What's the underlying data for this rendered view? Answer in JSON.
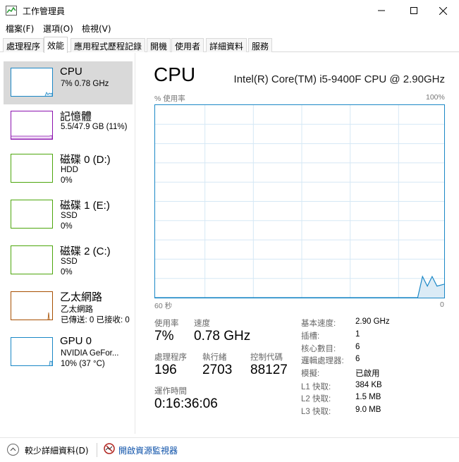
{
  "window": {
    "title": "工作管理員",
    "minimize_glyph": "—",
    "close_glyph": "✕"
  },
  "menu": {
    "items": [
      "檔案(F)",
      "選項(O)",
      "檢視(V)"
    ]
  },
  "tabs": {
    "items": [
      "處理程序",
      "效能",
      "應用程式歷程記錄",
      "開機",
      "使用者",
      "詳細資料",
      "服務"
    ],
    "active_index": 1
  },
  "resources": [
    {
      "name": "CPU",
      "line1": "7% 0.78 GHz",
      "line2": "",
      "color": "#1a87c6",
      "selected": true
    },
    {
      "name": "記憶體",
      "line1": "5.5/47.9 GB (11%)",
      "line2": "",
      "color": "#8b12ae",
      "selected": false
    },
    {
      "name": "磁碟 0 (D:)",
      "line1": "HDD",
      "line2": "0%",
      "color": "#4da60c",
      "selected": false
    },
    {
      "name": "磁碟 1 (E:)",
      "line1": "SSD",
      "line2": "0%",
      "color": "#4da60c",
      "selected": false
    },
    {
      "name": "磁碟 2 (C:)",
      "line1": "SSD",
      "line2": "0%",
      "color": "#4da60c",
      "selected": false
    },
    {
      "name": "乙太網路",
      "line1": "乙太網路",
      "line2": "已傳送: 0 已接收: 0",
      "color": "#a74f01",
      "selected": false
    },
    {
      "name": "GPU 0",
      "line1": "NVIDIA GeFor...",
      "line2": "10% (37 °C)",
      "color": "#1a87c6",
      "selected": false
    }
  ],
  "main": {
    "title": "CPU",
    "model": "Intel(R) Core(TM) i5-9400F CPU @ 2.90GHz",
    "graph_label": "% 使用率",
    "graph_max": "100%",
    "graph_time": "60 秒",
    "graph_zero": "0",
    "graph_color": "#1a87c6",
    "graph_fill": "#dbebf6",
    "grid_color": "#d5e8f5"
  },
  "stats": {
    "usage_label": "使用率",
    "usage_value": "7%",
    "speed_label": "速度",
    "speed_value": "0.78 GHz",
    "processes_label": "處理程序",
    "processes_value": "196",
    "threads_label": "執行緒",
    "threads_value": "2703",
    "handles_label": "控制代碼",
    "handles_value": "88127",
    "uptime_label": "運作時間",
    "uptime_value": "0:16:36:06"
  },
  "specs": [
    {
      "label": "基本速度:",
      "value": "2.90 GHz"
    },
    {
      "label": "插槽:",
      "value": "1"
    },
    {
      "label": "核心數目:",
      "value": "6"
    },
    {
      "label": "邏輯處理器:",
      "value": "6"
    },
    {
      "label": "模擬:",
      "value": "已啟用"
    },
    {
      "label": "L1 快取:",
      "value": "384 KB"
    },
    {
      "label": "L2 快取:",
      "value": "1.5 MB"
    },
    {
      "label": "L3 快取:",
      "value": "9.0 MB"
    }
  ],
  "footer": {
    "fewer_details": "較少詳細資料(D)",
    "open_resmon": "開啟資源監視器"
  },
  "chart_data": {
    "type": "area",
    "title": "",
    "xlabel": "60 秒",
    "ylabel": "% 使用率",
    "xlim": [
      60,
      0
    ],
    "ylim": [
      0,
      100
    ],
    "x": [
      60,
      5.5,
      4.5,
      3.5,
      2.5,
      1.5,
      0
    ],
    "series": [
      {
        "values": [
          0,
          0,
          11,
          6,
          11,
          6,
          7
        ]
      }
    ]
  }
}
